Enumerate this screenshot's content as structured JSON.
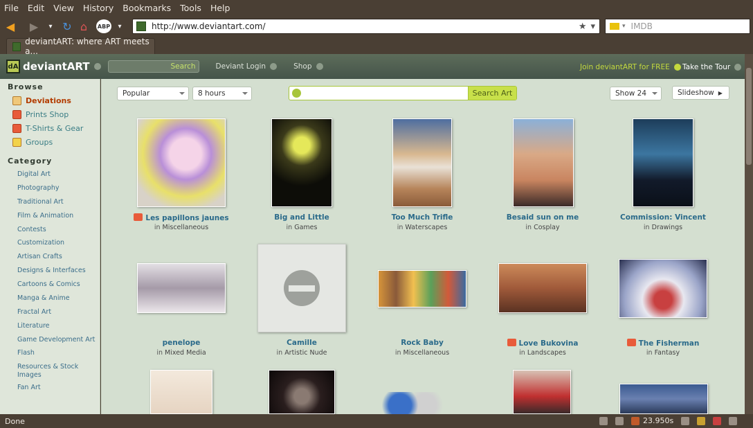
{
  "menu": [
    "File",
    "Edit",
    "View",
    "History",
    "Bookmarks",
    "Tools",
    "Help"
  ],
  "browser": {
    "url": "http://www.deviantart.com/",
    "search_placeholder": "IMDB",
    "tab_title": "deviantART: where ART meets a...",
    "status": "Done",
    "timer": "23.950s"
  },
  "header": {
    "logo": "deviantART",
    "search_btn": "Search",
    "login": "Deviant Login",
    "shop": "Shop",
    "join": "Join deviantART for FREE",
    "tour": "Take the Tour"
  },
  "sidebar": {
    "browse_heading": "Browse",
    "browse": [
      "Deviations",
      "Prints Shop",
      "T-Shirts & Gear",
      "Groups"
    ],
    "category_heading": "Category",
    "categories": [
      "Digital Art",
      "Photography",
      "Traditional Art",
      "Film & Animation",
      "Contests",
      "Customization",
      "Artisan Crafts",
      "Designs & Interfaces",
      "Cartoons & Comics",
      "Manga & Anime",
      "Fractal Art",
      "Literature",
      "Game Development Art",
      "Flash",
      "Resources & Stock Images",
      "Fan Art"
    ]
  },
  "toolbar": {
    "sort": "Popular",
    "period": "8 hours",
    "search_btn": "Search Art",
    "show": "Show 24",
    "slideshow": "Slideshow"
  },
  "in_label": "in",
  "deviations": [
    {
      "title": "Les papillons jaunes",
      "category": "Miscellaneous",
      "shop": true
    },
    {
      "title": "Big and Little",
      "category": "Games",
      "shop": false
    },
    {
      "title": "Too Much Trifle",
      "category": "Waterscapes",
      "shop": false
    },
    {
      "title": "Besaid sun on me",
      "category": "Cosplay",
      "shop": false
    },
    {
      "title": "Commission: Vincent",
      "category": "Drawings",
      "shop": false
    },
    {
      "title": "penelope",
      "category": "Mixed Media",
      "shop": false
    },
    {
      "title": "Camille",
      "category": "Artistic Nude",
      "shop": false
    },
    {
      "title": "Rock Baby",
      "category": "Miscellaneous",
      "shop": false
    },
    {
      "title": "Love Bukovina",
      "category": "Landscapes",
      "shop": true
    },
    {
      "title": "The Fisherman",
      "category": "Fantasy",
      "shop": true
    }
  ]
}
